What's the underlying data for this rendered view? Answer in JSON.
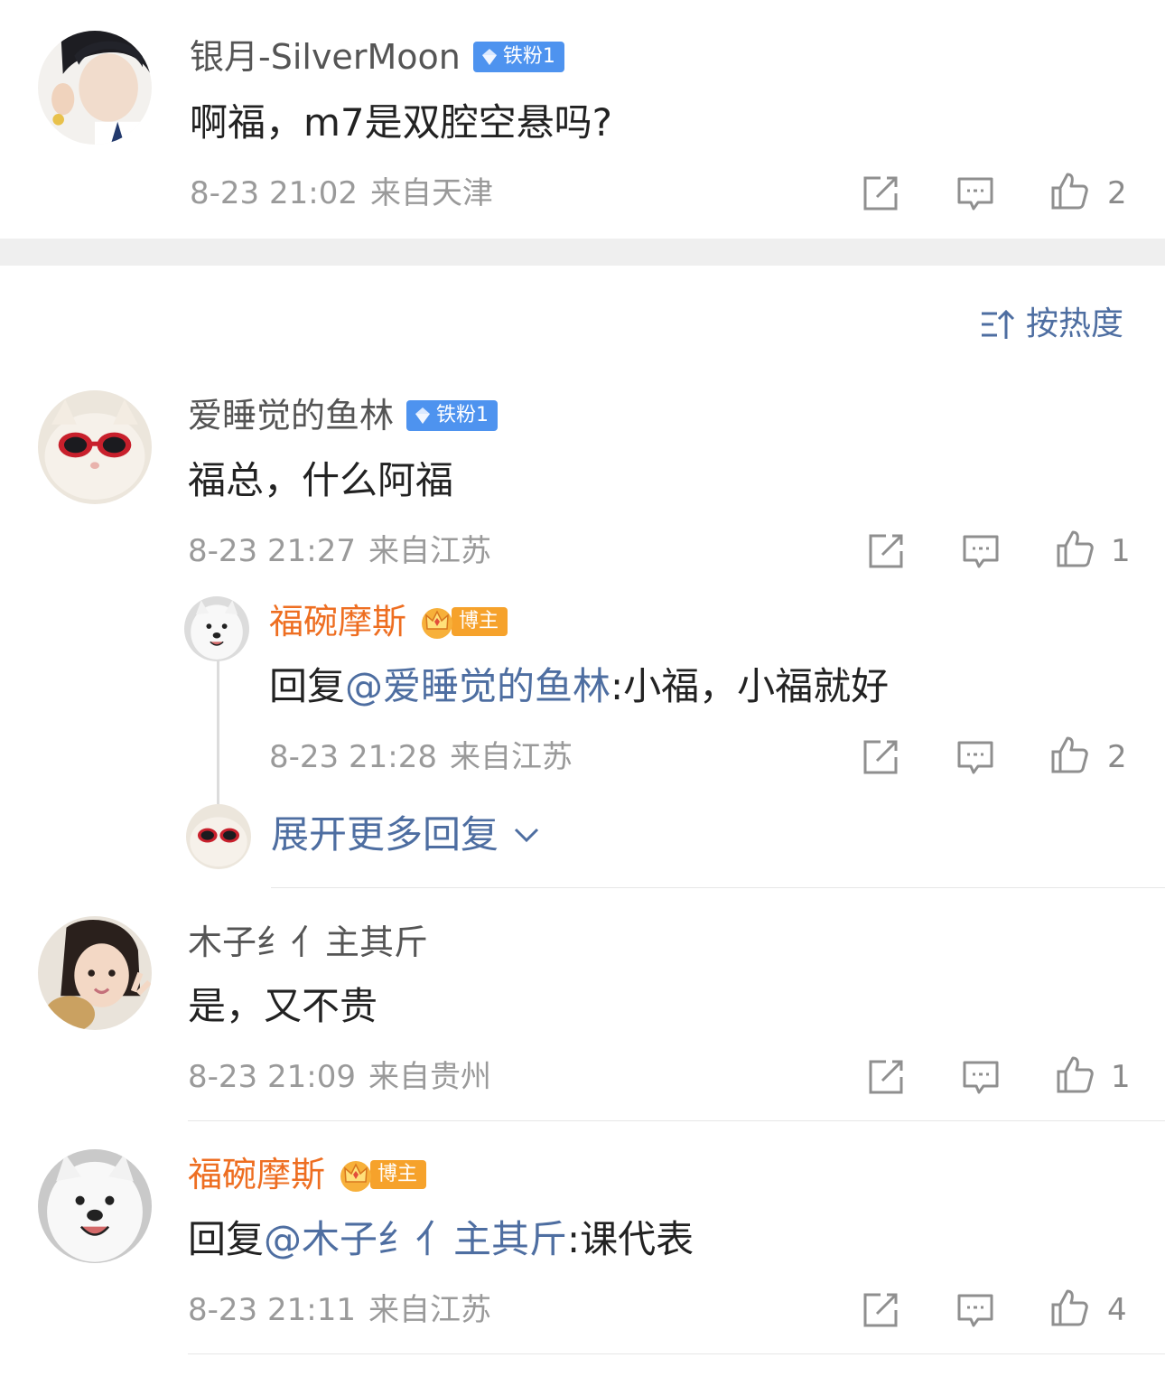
{
  "comments": [
    {
      "name": "银月-SilverMoon",
      "badge": "铁粉1",
      "text": "啊福，m7是双腔空悬吗?",
      "time": "8-23 21:02",
      "location": "来自天津",
      "likes": "2"
    },
    {
      "name": "爱睡觉的鱼林",
      "badge": "铁粉1",
      "text": "福总，什么阿福",
      "time": "8-23 21:27",
      "location": "来自江苏",
      "likes": "1",
      "reply": {
        "name": "福碗摩斯",
        "badge": "博主",
        "prefix": "回复",
        "mention": "@爱睡觉的鱼林",
        "text": ":小福，小福就好",
        "time": "8-23 21:28",
        "location": "来自江苏",
        "likes": "2"
      },
      "expand_label": "展开更多回复"
    },
    {
      "name": "木子纟亻主其斤",
      "text": "是，又不贵",
      "time": "8-23 21:09",
      "location": "来自贵州",
      "likes": "1"
    },
    {
      "name": "福碗摩斯",
      "badge": "博主",
      "prefix": "回复",
      "mention": "@木子纟亻主其斤",
      "text": ":课代表",
      "time": "8-23 21:11",
      "location": "来自江苏",
      "likes": "4"
    }
  ],
  "sort": {
    "label": "按热度"
  },
  "colors": {
    "link": "#4e6ea1",
    "blogger": "#ee6e21",
    "fan_badge": "#4e93ef",
    "host_badge": "#f6a22b"
  },
  "icons": [
    "share-icon",
    "comment-icon",
    "like-icon",
    "sort-icon",
    "chevron-down-icon",
    "diamond-icon",
    "crown-icon"
  ]
}
